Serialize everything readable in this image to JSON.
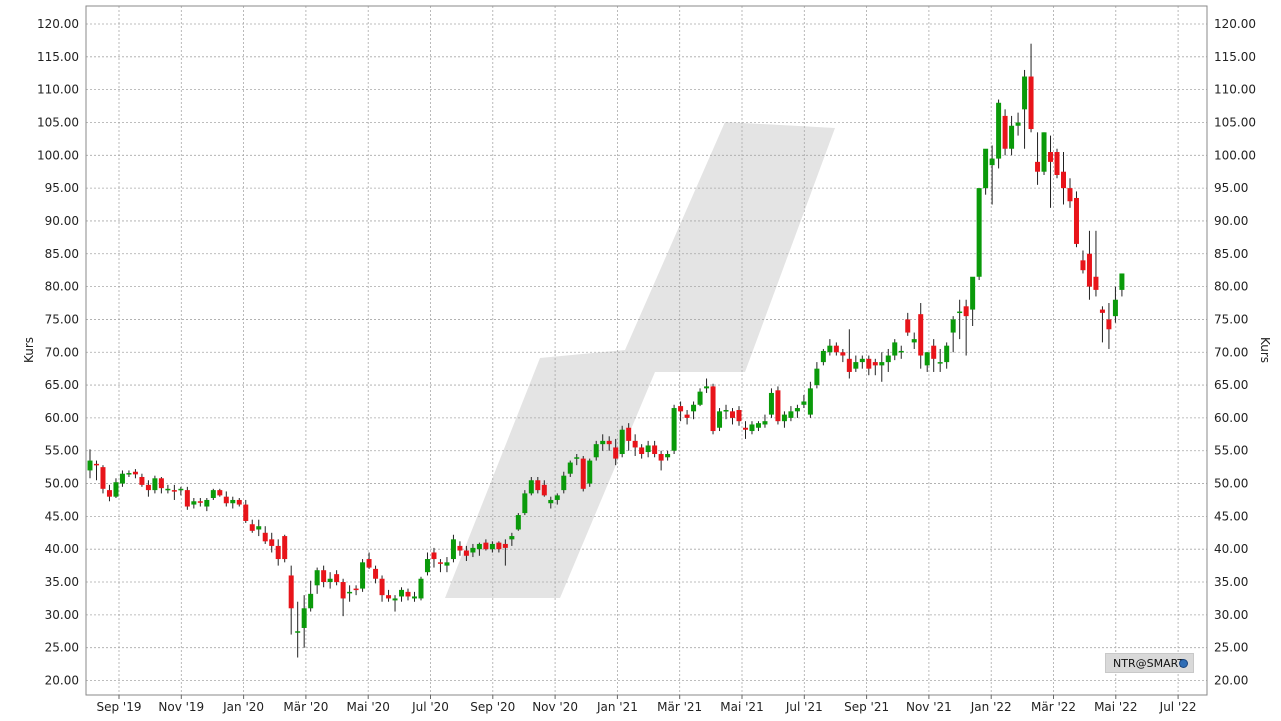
{
  "colors": {
    "up": "#0a9a0a",
    "down": "#e8141a",
    "grid": "#a8a8a8",
    "watermark": "#e4e4e4"
  },
  "legend": {
    "label": "NTR@SMART",
    "icon": "globe-icon"
  },
  "chart_data": {
    "type": "candlestick",
    "ylabel_left": "Kurs",
    "ylabel_right": "Kurs",
    "ylim": [
      18,
      122
    ],
    "grid": true,
    "legend_position": "bottom-right",
    "y_ticks": [
      "20.00",
      "25.00",
      "30.00",
      "35.00",
      "40.00",
      "45.00",
      "50.00",
      "55.00",
      "60.00",
      "65.00",
      "70.00",
      "75.00",
      "80.00",
      "85.00",
      "90.00",
      "95.00",
      "100.00",
      "105.00",
      "110.00",
      "115.00",
      "120.00"
    ],
    "x_ticks": [
      "Sep '19",
      "Nov '19",
      "Jan '20",
      "Mär '20",
      "Mai '20",
      "Jul '20",
      "Sep '20",
      "Nov '20",
      "Jan '21",
      "Mär '21",
      "Mai '21",
      "Jul '21",
      "Sep '21",
      "Nov '21",
      "Jan '22",
      "Mär '22",
      "Mai '22",
      "Jul '22"
    ],
    "first_week": "2019-08-12",
    "interval": "weekly",
    "ohlc": [
      [
        52.0,
        55.2,
        50.8,
        53.5
      ],
      [
        53.0,
        53.5,
        50.5,
        52.8
      ],
      [
        52.5,
        52.8,
        48.5,
        49.2
      ],
      [
        49.0,
        49.8,
        47.3,
        48.0
      ],
      [
        48.0,
        50.8,
        47.8,
        50.2
      ],
      [
        50.0,
        52.0,
        49.5,
        51.5
      ],
      [
        51.5,
        52.0,
        51.0,
        51.6
      ],
      [
        51.8,
        52.2,
        50.8,
        51.4
      ],
      [
        51.0,
        51.5,
        49.5,
        49.8
      ],
      [
        49.8,
        50.5,
        48.0,
        49.0
      ],
      [
        49.0,
        51.2,
        48.5,
        50.8
      ],
      [
        50.8,
        51.0,
        48.5,
        49.3
      ],
      [
        49.0,
        49.8,
        48.5,
        49.2
      ],
      [
        49.0,
        49.8,
        47.5,
        48.8
      ],
      [
        49.0,
        49.5,
        48.2,
        49.2
      ],
      [
        49.0,
        49.5,
        46.0,
        46.5
      ],
      [
        46.8,
        47.8,
        46.2,
        47.3
      ],
      [
        47.3,
        47.8,
        46.5,
        47.2
      ],
      [
        46.5,
        47.8,
        45.8,
        47.5
      ],
      [
        47.8,
        49.2,
        47.5,
        49.0
      ],
      [
        49.0,
        49.2,
        48.0,
        48.2
      ],
      [
        48.0,
        48.8,
        46.5,
        47.0
      ],
      [
        47.0,
        48.0,
        46.2,
        47.5
      ],
      [
        47.5,
        47.8,
        46.5,
        46.8
      ],
      [
        46.8,
        47.5,
        44.0,
        44.3
      ],
      [
        43.8,
        44.5,
        42.5,
        42.8
      ],
      [
        43.0,
        44.5,
        42.0,
        43.5
      ],
      [
        42.5,
        43.5,
        40.8,
        41.2
      ],
      [
        41.5,
        42.5,
        39.5,
        40.5
      ],
      [
        40.5,
        41.5,
        37.5,
        38.5
      ],
      [
        42.0,
        42.2,
        38.0,
        38.5
      ],
      [
        36.0,
        37.5,
        27.0,
        31.0
      ],
      [
        27.5,
        32.0,
        23.5,
        27.5
      ],
      [
        28.0,
        33.0,
        25.0,
        31.0
      ],
      [
        31.0,
        35.2,
        30.5,
        33.2
      ],
      [
        34.5,
        37.2,
        33.2,
        36.8
      ],
      [
        36.8,
        37.5,
        34.2,
        35.0
      ],
      [
        35.0,
        36.5,
        34.0,
        35.5
      ],
      [
        36.2,
        36.8,
        34.5,
        35.0
      ],
      [
        35.0,
        35.5,
        29.8,
        32.5
      ],
      [
        33.5,
        34.5,
        32.0,
        33.5
      ],
      [
        34.0,
        34.5,
        33.0,
        33.8
      ],
      [
        34.0,
        38.5,
        33.5,
        38.0
      ],
      [
        38.5,
        39.5,
        37.0,
        37.2
      ],
      [
        37.0,
        37.5,
        34.8,
        35.5
      ],
      [
        35.5,
        36.0,
        32.0,
        33.0
      ],
      [
        33.0,
        33.8,
        32.0,
        32.5
      ],
      [
        32.2,
        33.0,
        30.5,
        32.5
      ],
      [
        32.8,
        34.2,
        32.0,
        33.8
      ],
      [
        33.5,
        34.0,
        32.2,
        32.8
      ],
      [
        32.5,
        33.5,
        32.0,
        32.8
      ],
      [
        32.5,
        35.8,
        32.2,
        35.5
      ],
      [
        36.5,
        39.5,
        36.0,
        38.5
      ],
      [
        39.5,
        40.2,
        37.2,
        38.5
      ],
      [
        38.0,
        38.5,
        36.5,
        37.8
      ],
      [
        37.5,
        38.8,
        36.5,
        38.0
      ],
      [
        38.5,
        42.2,
        38.0,
        41.5
      ],
      [
        40.5,
        41.2,
        39.0,
        39.8
      ],
      [
        39.8,
        40.5,
        38.2,
        39.0
      ],
      [
        39.5,
        40.8,
        38.8,
        40.2
      ],
      [
        40.0,
        41.0,
        39.0,
        40.8
      ],
      [
        41.0,
        41.5,
        39.8,
        40.0
      ],
      [
        40.0,
        41.2,
        39.5,
        40.8
      ],
      [
        41.0,
        41.2,
        39.5,
        40.0
      ],
      [
        40.8,
        41.5,
        37.5,
        40.2
      ],
      [
        41.5,
        42.5,
        40.5,
        42.0
      ],
      [
        43.0,
        45.5,
        42.8,
        45.2
      ],
      [
        45.5,
        49.0,
        45.2,
        48.5
      ],
      [
        48.5,
        51.0,
        48.2,
        50.5
      ],
      [
        50.5,
        51.0,
        48.5,
        49.0
      ],
      [
        49.8,
        50.5,
        48.0,
        48.2
      ],
      [
        47.0,
        48.0,
        46.2,
        47.5
      ],
      [
        47.5,
        48.5,
        46.8,
        48.2
      ],
      [
        49.0,
        51.8,
        48.5,
        51.2
      ],
      [
        51.5,
        53.5,
        51.0,
        53.2
      ],
      [
        53.8,
        54.5,
        52.8,
        54.0
      ],
      [
        53.8,
        54.2,
        48.8,
        49.2
      ],
      [
        50.0,
        53.8,
        49.5,
        53.5
      ],
      [
        54.0,
        56.5,
        53.5,
        56.0
      ],
      [
        56.0,
        57.5,
        55.0,
        56.5
      ],
      [
        56.5,
        57.2,
        55.0,
        56.0
      ],
      [
        55.5,
        56.8,
        52.8,
        53.8
      ],
      [
        54.5,
        58.8,
        54.0,
        58.2
      ],
      [
        58.5,
        59.2,
        55.0,
        56.5
      ],
      [
        56.5,
        57.5,
        54.2,
        55.5
      ],
      [
        55.5,
        56.0,
        53.8,
        54.5
      ],
      [
        54.8,
        56.5,
        54.0,
        55.8
      ],
      [
        55.8,
        56.5,
        54.0,
        54.5
      ],
      [
        54.5,
        55.0,
        52.0,
        53.5
      ],
      [
        54.0,
        55.0,
        53.5,
        54.5
      ],
      [
        55.0,
        62.0,
        54.5,
        61.5
      ],
      [
        61.8,
        62.5,
        59.5,
        61.0
      ],
      [
        60.5,
        61.2,
        59.0,
        60.0
      ],
      [
        61.0,
        62.5,
        59.8,
        62.0
      ],
      [
        62.0,
        64.5,
        61.8,
        64.0
      ],
      [
        64.5,
        66.0,
        63.8,
        64.8
      ],
      [
        64.8,
        65.2,
        57.5,
        58.0
      ],
      [
        58.5,
        61.5,
        58.0,
        61.0
      ],
      [
        61.0,
        62.0,
        59.8,
        61.2
      ],
      [
        61.0,
        61.5,
        59.0,
        60.0
      ],
      [
        61.2,
        61.8,
        58.8,
        59.5
      ],
      [
        58.5,
        59.5,
        56.8,
        58.2
      ],
      [
        58.0,
        59.5,
        57.5,
        59.0
      ],
      [
        58.5,
        59.5,
        58.0,
        59.2
      ],
      [
        59.0,
        60.5,
        58.5,
        59.5
      ],
      [
        60.5,
        64.5,
        60.0,
        63.8
      ],
      [
        64.2,
        64.8,
        59.0,
        59.5
      ],
      [
        59.5,
        61.0,
        58.5,
        60.5
      ],
      [
        60.0,
        61.8,
        59.5,
        61.0
      ],
      [
        61.0,
        62.0,
        60.0,
        61.5
      ],
      [
        62.0,
        63.5,
        61.5,
        62.5
      ],
      [
        60.5,
        65.5,
        60.0,
        64.5
      ],
      [
        65.0,
        68.5,
        64.5,
        67.5
      ],
      [
        68.5,
        70.5,
        68.0,
        70.2
      ],
      [
        70.0,
        72.0,
        69.5,
        71.0
      ],
      [
        71.0,
        71.5,
        69.5,
        70.0
      ],
      [
        70.0,
        70.5,
        68.5,
        69.5
      ],
      [
        69.0,
        73.5,
        66.0,
        67.0
      ],
      [
        67.5,
        69.5,
        67.0,
        68.5
      ],
      [
        68.5,
        69.5,
        67.5,
        69.0
      ],
      [
        69.0,
        69.5,
        66.5,
        67.5
      ],
      [
        68.5,
        69.0,
        66.5,
        68.0
      ],
      [
        68.0,
        70.0,
        65.5,
        68.5
      ],
      [
        68.5,
        70.5,
        67.0,
        69.5
      ],
      [
        69.5,
        72.0,
        68.8,
        71.5
      ],
      [
        70.0,
        71.0,
        69.0,
        70.2
      ],
      [
        75.0,
        76.0,
        72.5,
        73.0
      ],
      [
        71.5,
        73.0,
        70.5,
        72.0
      ],
      [
        75.8,
        77.5,
        67.5,
        69.5
      ],
      [
        68.0,
        70.0,
        67.0,
        70.0
      ],
      [
        71.0,
        72.0,
        67.0,
        69.0
      ],
      [
        68.5,
        70.5,
        67.0,
        68.5
      ],
      [
        68.5,
        71.5,
        67.5,
        71.0
      ],
      [
        73.0,
        75.5,
        70.0,
        75.0
      ],
      [
        76.0,
        78.0,
        72.0,
        76.2
      ],
      [
        77.0,
        78.0,
        69.5,
        75.5
      ],
      [
        76.5,
        80.0,
        74.0,
        81.5
      ],
      [
        81.5,
        91.0,
        81.0,
        95.0
      ],
      [
        95.0,
        100.5,
        94.0,
        101.0
      ],
      [
        98.5,
        101.5,
        92.5,
        99.5
      ],
      [
        99.5,
        108.5,
        98.0,
        108.0
      ],
      [
        106.0,
        107.0,
        100.0,
        101.0
      ],
      [
        101.0,
        106.0,
        100.0,
        104.5
      ],
      [
        104.5,
        106.5,
        103.0,
        105.0
      ],
      [
        107.0,
        113.0,
        101.0,
        112.0
      ],
      [
        112.0,
        117.0,
        103.5,
        104.0
      ],
      [
        99.0,
        103.5,
        95.5,
        97.5
      ],
      [
        97.5,
        103.5,
        97.0,
        103.5
      ],
      [
        100.5,
        103.0,
        92.0,
        99.0
      ],
      [
        100.5,
        101.0,
        96.5,
        97.0
      ],
      [
        97.5,
        100.5,
        92.5,
        95.0
      ],
      [
        95.0,
        96.5,
        92.0,
        93.0
      ],
      [
        93.5,
        94.5,
        86.0,
        86.5
      ],
      [
        84.0,
        85.5,
        82.0,
        82.5
      ],
      [
        85.0,
        88.5,
        78.0,
        80.0
      ],
      [
        81.5,
        88.5,
        78.5,
        79.5
      ],
      [
        76.5,
        77.0,
        71.5,
        76.0
      ],
      [
        75.0,
        77.5,
        70.5,
        73.5
      ],
      [
        75.5,
        80.0,
        74.5,
        78.0
      ],
      [
        79.5,
        82.0,
        78.5,
        82.0
      ]
    ]
  }
}
